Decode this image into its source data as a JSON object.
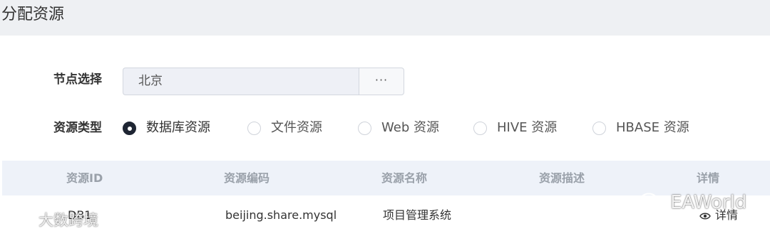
{
  "page": {
    "title": "分配资源"
  },
  "form": {
    "node_label": "节点选择",
    "node_value": "北京",
    "node_button": "···",
    "type_label": "资源类型",
    "types": [
      {
        "label": "数据库资源",
        "checked": true
      },
      {
        "label": "文件资源",
        "checked": false
      },
      {
        "label": "Web 资源",
        "checked": false
      },
      {
        "label": "HIVE 资源",
        "checked": false
      },
      {
        "label": "HBASE 资源",
        "checked": false
      }
    ]
  },
  "table": {
    "columns": [
      "资源ID",
      "资源编码",
      "资源名称",
      "资源描述",
      "详情"
    ],
    "rows": [
      {
        "id": "DB1",
        "code": "beijing.share.mysql",
        "name": "项目管理系统",
        "desc": "",
        "detail": "详情"
      }
    ]
  },
  "watermarks": {
    "left": "大数跨境",
    "right": "EAWorld"
  },
  "colors": {
    "header_bg": "#eef0f3",
    "table_head_bg": "#eef2f9",
    "radio_checked": "#1e2533"
  }
}
